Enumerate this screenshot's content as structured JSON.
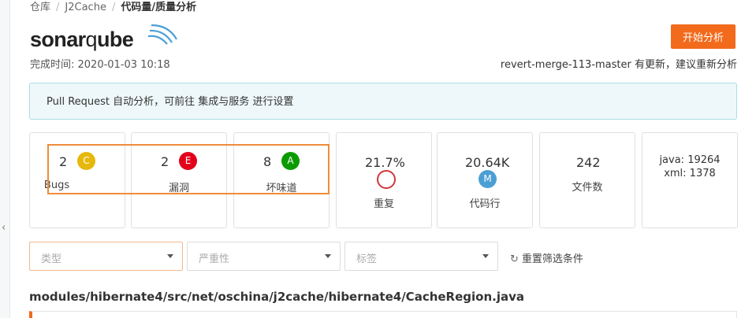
{
  "breadcrumb": {
    "items": [
      "仓库",
      "J2Cache"
    ],
    "current": "代码量/质量分析"
  },
  "logo": {
    "text_main": "sonar",
    "text_q": "q",
    "text_rest": "ube"
  },
  "header": {
    "completed_label": "完成时间: 2020-01-03 10:18",
    "start_button": "开始分析",
    "update_note": "revert-merge-113-master 有更新，建议重新分析"
  },
  "notice": {
    "text": "Pull Request 自动分析，可前往 集成与服务 进行设置"
  },
  "metrics": {
    "bugs": {
      "value": "2",
      "grade": "C",
      "label": "Bugs",
      "color": "#e5b80b"
    },
    "vulnerabilities": {
      "value": "2",
      "grade": "E",
      "label": "漏洞",
      "color": "#e3001b"
    },
    "code_smells": {
      "value": "8",
      "grade": "A",
      "label": "坏味道",
      "color": "#0a9b00"
    },
    "duplication": {
      "value": "21.7%",
      "label": "重复",
      "ring_color": "#d0363c"
    },
    "lines": {
      "value": "20.64K",
      "size": "M",
      "label": "代码行"
    },
    "files": {
      "value": "242",
      "label": "文件数"
    },
    "languages": [
      "java: 19264",
      "xml: 1378"
    ]
  },
  "filters": {
    "type_placeholder": "类型",
    "severity_placeholder": "严重性",
    "tag_placeholder": "标签",
    "reset_label": "重置筛选条件"
  },
  "file": {
    "path": "modules/hibernate4/src/net/oschina/j2cache/hibernate4/CacheRegion.java"
  }
}
